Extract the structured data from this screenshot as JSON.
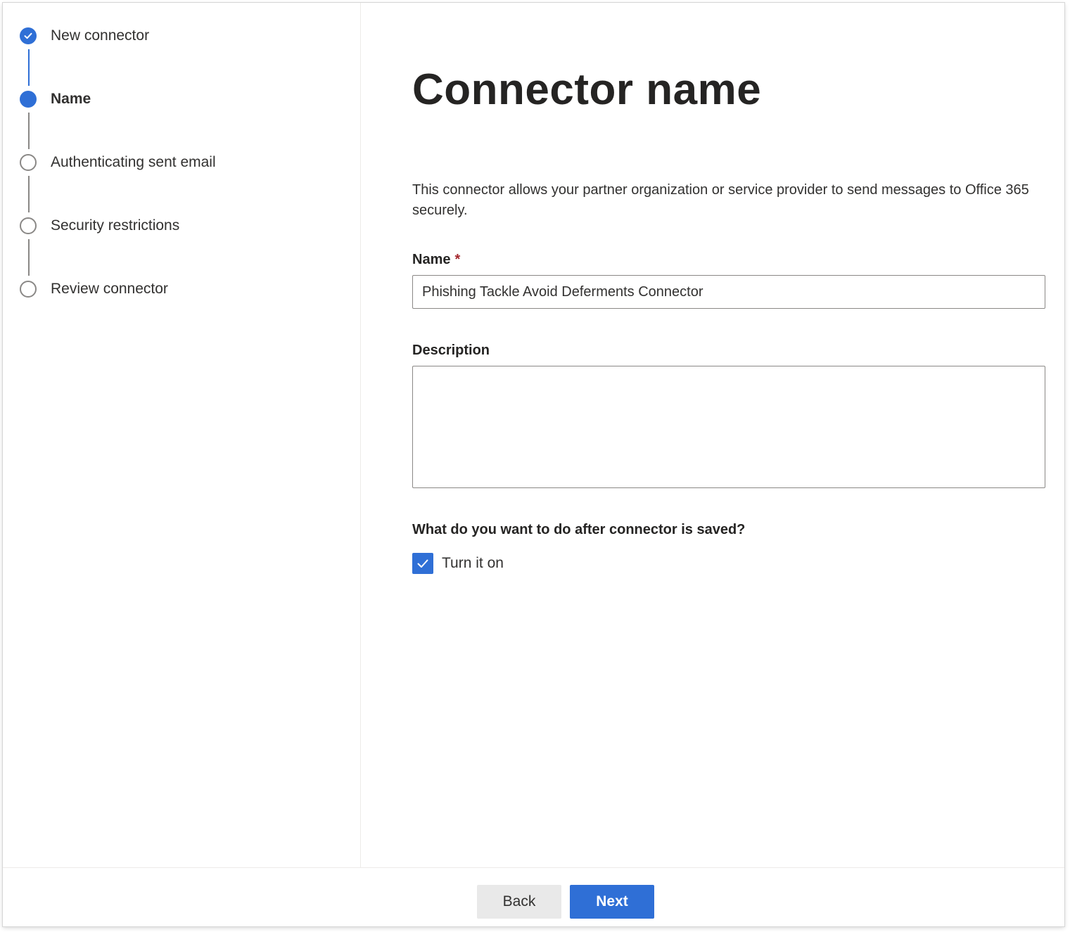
{
  "stepper": {
    "steps": [
      {
        "label": "New connector",
        "state": "done"
      },
      {
        "label": "Name",
        "state": "current"
      },
      {
        "label": "Authenticating sent email",
        "state": "todo"
      },
      {
        "label": "Security restrictions",
        "state": "todo"
      },
      {
        "label": "Review connector",
        "state": "todo"
      }
    ]
  },
  "main": {
    "title": "Connector name",
    "intro": "This connector allows your partner organization or service provider to send messages to Office 365 securely.",
    "name_label": "Name",
    "required_mark": "*",
    "name_value": "Phishing Tackle Avoid Deferments Connector",
    "description_label": "Description",
    "description_value": "",
    "question": "What do you want to do after connector is saved?",
    "turn_on_label": "Turn it on",
    "turn_on_checked": true
  },
  "footer": {
    "back_label": "Back",
    "next_label": "Next"
  },
  "colors": {
    "accent": "#2f6fd6",
    "required": "#a4262c"
  }
}
